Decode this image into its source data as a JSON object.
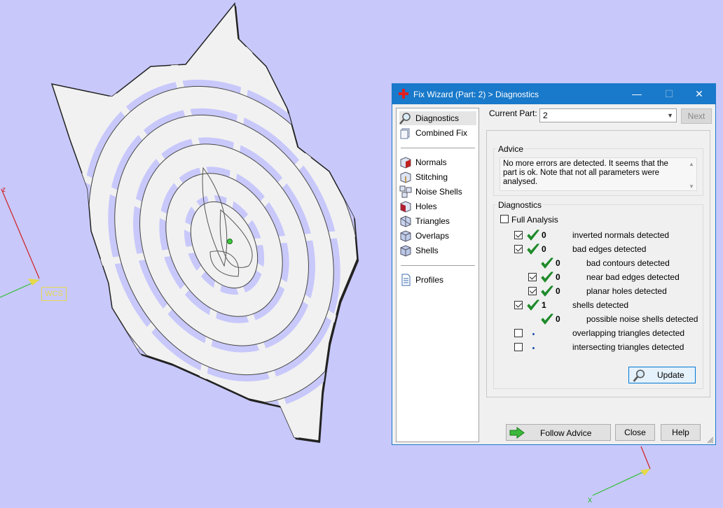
{
  "viewport": {
    "wcs_label": "WCS",
    "axis_z": "z",
    "axis_x": "x"
  },
  "dialog": {
    "title": "Fix Wizard (Part: 2) > Diagnostics",
    "window_buttons": {
      "minimize": "—",
      "maximize": "☐",
      "close": "✕"
    },
    "nav": {
      "items_top": [
        {
          "label": "Diagnostics",
          "icon": "magnifier-icon",
          "selected": true
        },
        {
          "label": "Combined Fix",
          "icon": "combined-fix-icon",
          "selected": false
        }
      ],
      "items_mid": [
        {
          "label": "Normals",
          "icon": "normals-cube-icon"
        },
        {
          "label": "Stitching",
          "icon": "stitching-cube-icon"
        },
        {
          "label": "Noise Shells",
          "icon": "noise-shells-icon"
        },
        {
          "label": "Holes",
          "icon": "holes-cube-icon"
        },
        {
          "label": "Triangles",
          "icon": "triangles-cube-icon"
        },
        {
          "label": "Overlaps",
          "icon": "overlaps-cube-icon"
        },
        {
          "label": "Shells",
          "icon": "shells-cube-icon"
        }
      ],
      "items_bottom": [
        {
          "label": "Profiles",
          "icon": "profiles-document-icon"
        }
      ]
    },
    "current_part_label": "Current Part:",
    "current_part_value": "2",
    "next_label": "Next",
    "advice": {
      "title": "Advice",
      "text": "No more errors are detected. It seems that the part is ok. Note that not all parameters were analysed."
    },
    "diagnostics": {
      "title": "Diagnostics",
      "full_analysis_label": "Full Analysis",
      "rows": [
        {
          "checkbox": true,
          "checked": true,
          "status": "ok",
          "count": "0",
          "label": "inverted normals detected",
          "indent": 0
        },
        {
          "checkbox": true,
          "checked": true,
          "status": "ok",
          "count": "0",
          "label": "bad edges detected",
          "indent": 0
        },
        {
          "checkbox": false,
          "checked": false,
          "status": "ok",
          "count": "0",
          "label": "bad contours detected",
          "indent": 1
        },
        {
          "checkbox": true,
          "checked": true,
          "status": "ok",
          "count": "0",
          "label": "near bad edges detected",
          "indent": 1
        },
        {
          "checkbox": true,
          "checked": true,
          "status": "ok",
          "count": "0",
          "label": "planar holes detected",
          "indent": 1
        },
        {
          "checkbox": true,
          "checked": true,
          "status": "ok",
          "count": "1",
          "label": "shells detected",
          "indent": 0
        },
        {
          "checkbox": false,
          "checked": false,
          "status": "ok",
          "count": "0",
          "label": "possible noise shells detected",
          "indent": 1
        },
        {
          "checkbox": true,
          "checked": false,
          "status": "dot",
          "count": "",
          "label": "overlapping triangles detected",
          "indent": 0
        },
        {
          "checkbox": true,
          "checked": false,
          "status": "dot",
          "count": "",
          "label": "intersecting triangles detected",
          "indent": 0
        }
      ],
      "update_label": "Update"
    },
    "buttons": {
      "follow_advice": "Follow Advice",
      "close": "Close",
      "help": "Help"
    }
  },
  "colors": {
    "background": "#c8c8fb",
    "titlebar": "#1979ca",
    "tick_green": "#1e8a2a",
    "wcs_yellow": "#e6d84a"
  }
}
